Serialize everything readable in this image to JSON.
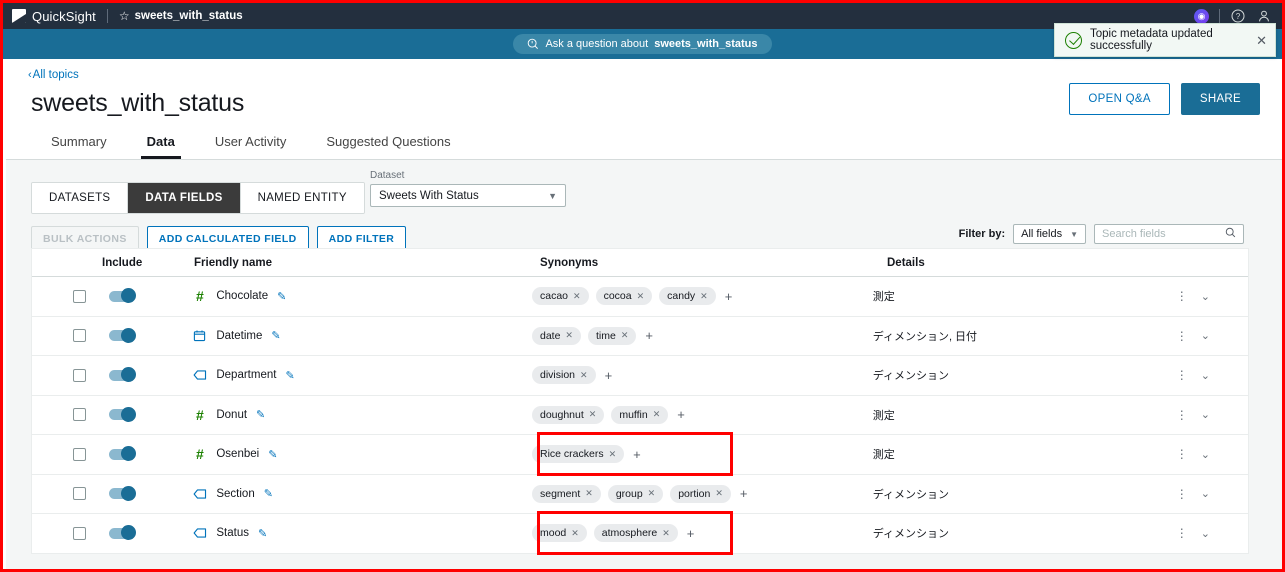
{
  "topbar": {
    "product": "QuickSight",
    "star_icon": "star-icon",
    "topic_name": "sweets_with_status",
    "notifications_icon": "notifications-badge-icon",
    "help_icon": "help-icon",
    "account_icon": "user-account-icon"
  },
  "banner": {
    "ask_icon": "q-search-icon",
    "ask_prefix": "Ask a question about ",
    "ask_topic": "sweets_with_status"
  },
  "toast": {
    "icon": "success-check-icon",
    "message": "Topic metadata updated successfully",
    "close_icon": "close-icon"
  },
  "header": {
    "breadcrumb_chevron": "chevron-left-icon",
    "breadcrumb": "All topics",
    "title": "sweets_with_status",
    "open_qa_label": "OPEN Q&A",
    "share_label": "SHARE",
    "tabs": [
      {
        "label": "Summary",
        "active": false
      },
      {
        "label": "Data",
        "active": true
      },
      {
        "label": "User Activity",
        "active": false
      },
      {
        "label": "Suggested Questions",
        "active": false
      }
    ]
  },
  "panel": {
    "subtabs": [
      {
        "label": "DATASETS",
        "active": false
      },
      {
        "label": "DATA FIELDS",
        "active": true
      },
      {
        "label": "NAMED ENTITY",
        "active": false
      }
    ],
    "dataset": {
      "label": "Dataset",
      "value": "Sweets With Status",
      "caret_icon": "chevron-down-icon"
    },
    "actions": {
      "bulk_actions": "BULK ACTIONS",
      "add_calculated_field": "ADD CALCULATED FIELD",
      "add_filter": "ADD FILTER"
    },
    "filter": {
      "label": "Filter by:",
      "value": "All fields",
      "caret_icon": "chevron-down-icon",
      "search_placeholder": "Search fields",
      "search_value": "",
      "search_icon": "search-icon"
    }
  },
  "table": {
    "columns": {
      "include": "Include",
      "friendly_name": "Friendly name",
      "synonyms": "Synonyms",
      "details": "Details"
    },
    "rows": [
      {
        "checked": false,
        "included": true,
        "type_icon": "measure-hash-icon",
        "type": "measure",
        "name": "Chocolate",
        "edit_icon": "edit-pencil-icon",
        "synonyms": [
          "cacao",
          "cocoa",
          "candy"
        ],
        "add_synonym": "+",
        "details": "測定",
        "menu_icon": "kebab-menu-icon",
        "expand_icon": "chevron-down-icon",
        "highlighted": false
      },
      {
        "checked": false,
        "included": true,
        "type_icon": "calendar-date-icon",
        "type": "date",
        "name": "Datetime",
        "edit_icon": "edit-pencil-icon",
        "synonyms": [
          "date",
          "time"
        ],
        "add_synonym": "+",
        "details": "ディメンション, 日付",
        "menu_icon": "kebab-menu-icon",
        "expand_icon": "chevron-down-icon",
        "highlighted": false
      },
      {
        "checked": false,
        "included": true,
        "type_icon": "dimension-tag-icon",
        "type": "dimension",
        "name": "Department",
        "edit_icon": "edit-pencil-icon",
        "synonyms": [
          "division"
        ],
        "add_synonym": "+",
        "details": "ディメンション",
        "menu_icon": "kebab-menu-icon",
        "expand_icon": "chevron-down-icon",
        "highlighted": false
      },
      {
        "checked": false,
        "included": true,
        "type_icon": "measure-hash-icon",
        "type": "measure",
        "name": "Donut",
        "edit_icon": "edit-pencil-icon",
        "synonyms": [
          "doughnut",
          "muffin"
        ],
        "add_synonym": "+",
        "details": "測定",
        "menu_icon": "kebab-menu-icon",
        "expand_icon": "chevron-down-icon",
        "highlighted": false
      },
      {
        "checked": false,
        "included": true,
        "type_icon": "measure-hash-icon",
        "type": "measure",
        "name": "Osenbei",
        "edit_icon": "edit-pencil-icon",
        "synonyms": [
          "Rice crackers"
        ],
        "add_synonym": "+",
        "details": "測定",
        "menu_icon": "kebab-menu-icon",
        "expand_icon": "chevron-down-icon",
        "highlighted": true
      },
      {
        "checked": false,
        "included": true,
        "type_icon": "dimension-tag-icon",
        "type": "dimension",
        "name": "Section",
        "edit_icon": "edit-pencil-icon",
        "synonyms": [
          "segment",
          "group",
          "portion"
        ],
        "add_synonym": "+",
        "details": "ディメンション",
        "menu_icon": "kebab-menu-icon",
        "expand_icon": "chevron-down-icon",
        "highlighted": false
      },
      {
        "checked": false,
        "included": true,
        "type_icon": "dimension-tag-icon",
        "type": "dimension",
        "name": "Status",
        "edit_icon": "edit-pencil-icon",
        "synonyms": [
          "mood",
          "atmosphere"
        ],
        "add_synonym": "+",
        "details": "ディメンション",
        "menu_icon": "kebab-menu-icon",
        "expand_icon": "chevron-down-icon",
        "highlighted": true
      }
    ]
  },
  "colors": {
    "topbar": "#232f3e",
    "banner": "#1a6d96",
    "accent_link": "#0073bb",
    "measure_green": "#1d8102",
    "highlight_red": "#ff0000",
    "panel_bg": "#f4f6f6"
  }
}
